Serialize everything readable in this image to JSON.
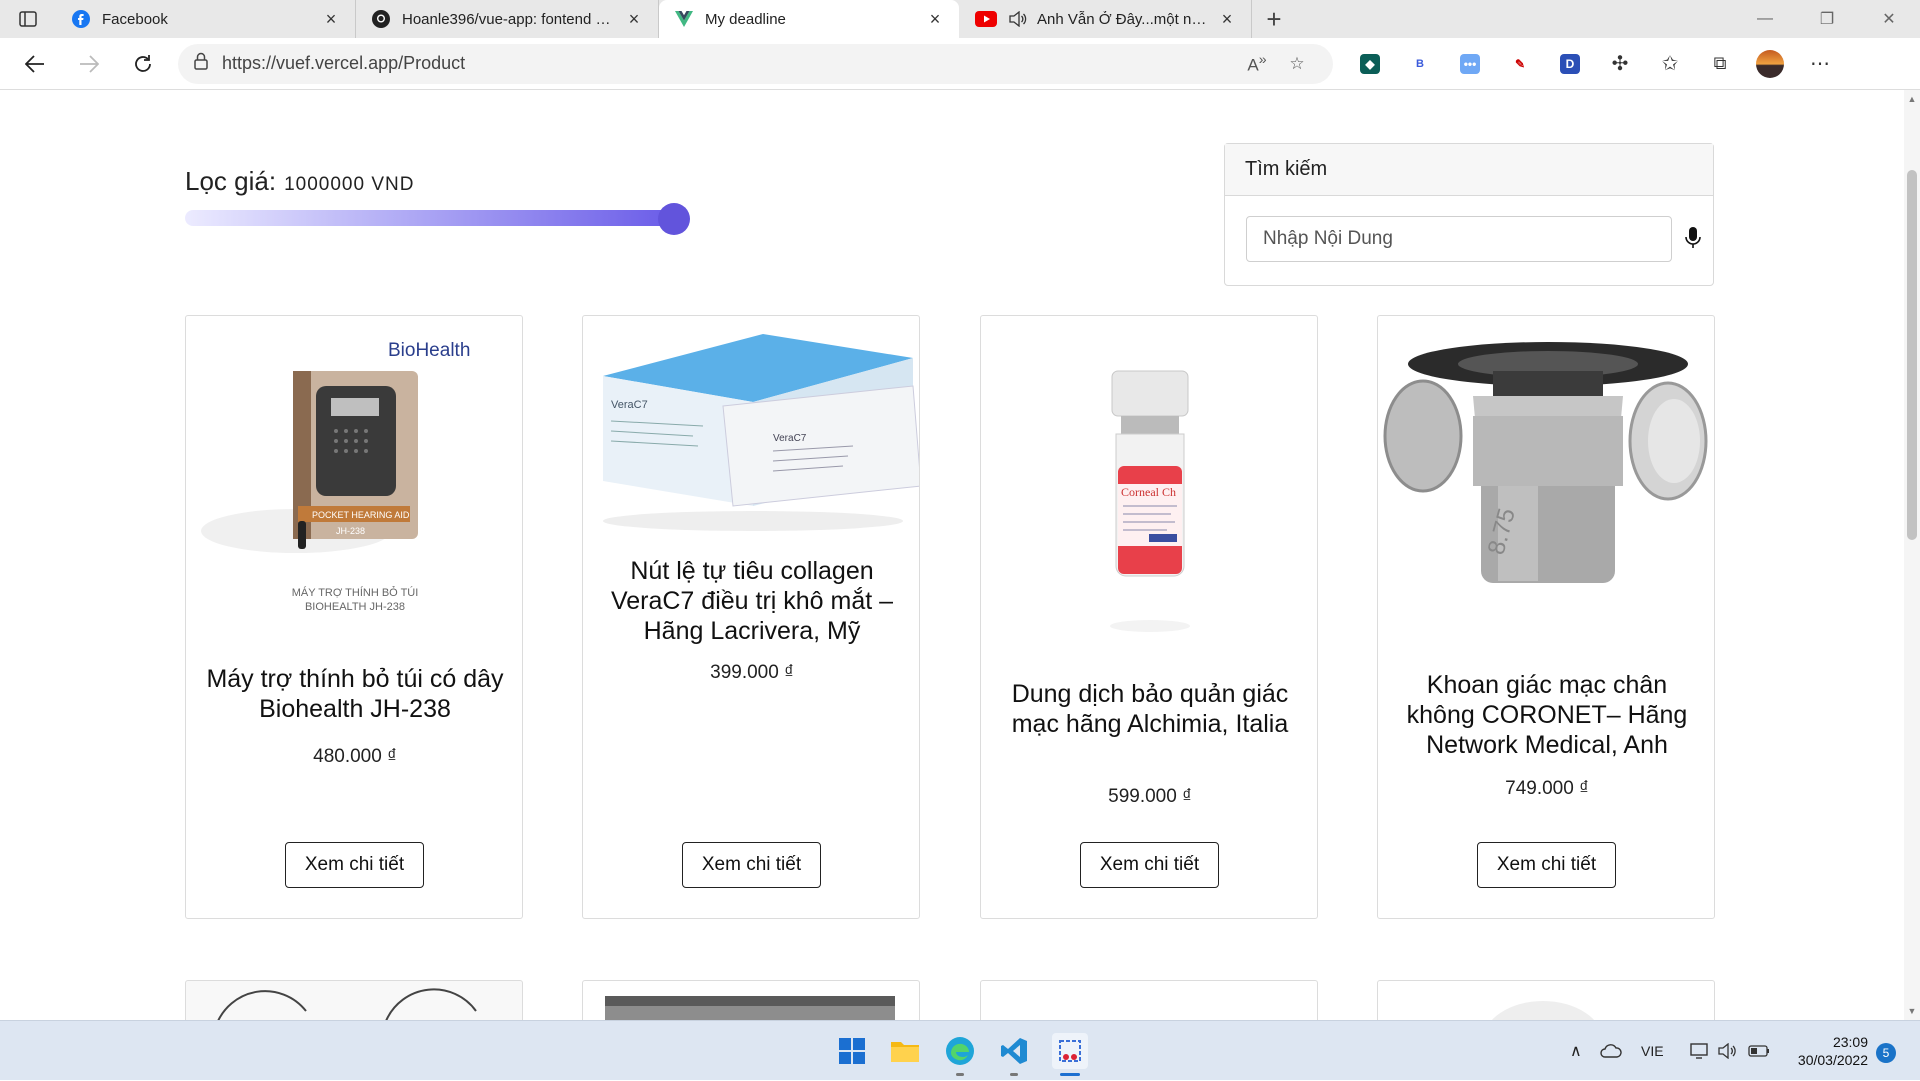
{
  "browser": {
    "tabs": [
      {
        "label": "Facebook",
        "icon": "facebook-icon"
      },
      {
        "label": "Hoanle396/vue-app: fontend with",
        "icon": "github-icon"
      },
      {
        "label": "My deadline",
        "icon": "vue-icon",
        "active": true
      },
      {
        "label": "Anh Vẫn Ở Đây...một người",
        "icon": "youtube-icon"
      }
    ],
    "url": "https://vuef.vercel.app/Product"
  },
  "page": {
    "filter": {
      "label": "Lọc giá:",
      "value": "1000000 VND",
      "slider_fraction": 1.0
    },
    "search": {
      "title": "Tìm kiếm",
      "placeholder": "Nhập Nội Dung"
    },
    "products": [
      {
        "name": "Máy trợ thính bỏ túi có dây Biohealth JH-238",
        "price": "480.000 ₫",
        "button": "Xem chi tiết",
        "image_brand": "BioHealth",
        "image_caption": "MÁY TRỢ THÍNH BỎ TÚI BIOHEALTH JH-238",
        "image_box_text": "POCKET HEARING AID",
        "image_model": "JH-238"
      },
      {
        "name": "Nút lệ tự tiêu collagen VeraC7 điều trị khô mắt – Hãng Lacrivera, Mỹ",
        "price": "399.000 ₫",
        "button": "Xem chi tiết",
        "image_label": "VeraC7"
      },
      {
        "name": "Dung dịch bảo quản giác mạc hãng Alchimia, Italia",
        "price": "599.000 ₫",
        "button": "Xem chi tiết",
        "image_label": "Corneal Ch"
      },
      {
        "name": "Khoan giác mạc chân không CORONET– Hãng Network Medical, Anh",
        "price": "749.000 ₫",
        "button": "Xem chi tiết",
        "image_label": "8.75"
      }
    ]
  },
  "taskbar": {
    "language": "VIE",
    "time": "23:09",
    "date": "30/03/2022",
    "notifications": "5"
  }
}
